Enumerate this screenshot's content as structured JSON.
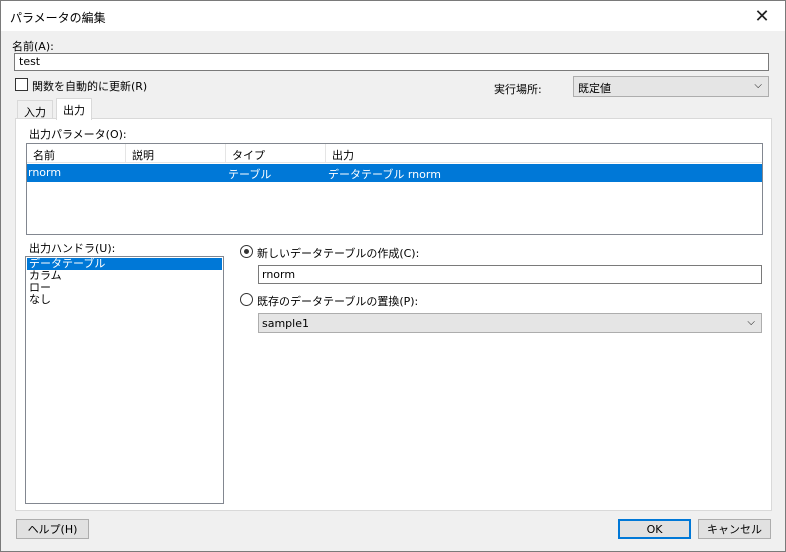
{
  "window": {
    "title": "パラメータの編集",
    "close_glyph": "✕"
  },
  "name_field": {
    "label": "名前(A):",
    "value": "test"
  },
  "auto_update": {
    "label": "関数を自動的に更新(R)",
    "checked": false
  },
  "run_location": {
    "label": "実行場所:",
    "value": "既定値",
    "chevron": "⌵"
  },
  "tabs": [
    {
      "label": "入力",
      "active": false
    },
    {
      "label": "出力",
      "active": true
    }
  ],
  "output_params": {
    "label": "出力パラメータ(O):",
    "columns": [
      "名前",
      "説明",
      "タイプ",
      "出力"
    ],
    "rows": [
      {
        "name": "rnorm",
        "description": "",
        "type": "テーブル",
        "output": "データテーブル rnorm",
        "selected": true
      }
    ]
  },
  "output_handler": {
    "label": "出力ハンドラ(U):",
    "items": [
      {
        "label": "データテーブル",
        "selected": true
      },
      {
        "label": "カラム",
        "selected": false
      },
      {
        "label": "ロー",
        "selected": false
      },
      {
        "label": "なし",
        "selected": false
      }
    ]
  },
  "new_table": {
    "label": "新しいデータテーブルの作成(C):",
    "selected": true,
    "value": "rnorm"
  },
  "replace_table": {
    "label": "既存のデータテーブルの置換(P):",
    "selected": false,
    "value": "sample1",
    "chevron": "⌵"
  },
  "buttons": {
    "help": "ヘルプ(H)",
    "ok": "OK",
    "cancel": "キャンセル"
  },
  "colors": {
    "selection": "#0078d7",
    "default_button_border": "#0078d7",
    "background": "#f0f0f0"
  }
}
